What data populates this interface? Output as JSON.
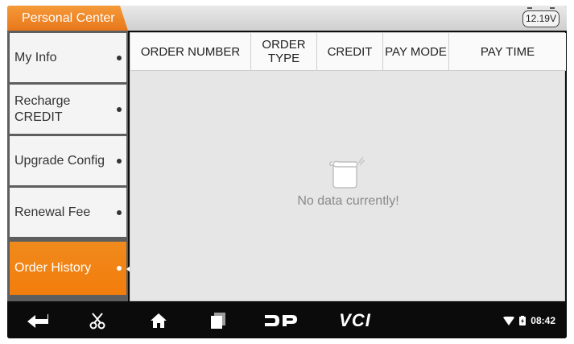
{
  "header": {
    "title": "Personal Center",
    "battery_voltage": "12.19V"
  },
  "sidebar": {
    "items": [
      {
        "label": "My Info"
      },
      {
        "label": "Recharge CREDIT"
      },
      {
        "label": "Upgrade Config"
      },
      {
        "label": "Renewal Fee"
      },
      {
        "label": "Order History"
      }
    ],
    "active_index": 4
  },
  "table": {
    "columns": [
      "ORDER NUMBER",
      "ORDER TYPE",
      "CREDIT",
      "PAY MODE",
      "PAY TIME"
    ],
    "rows": [],
    "empty_message": "No data currently!"
  },
  "navbar": {
    "buttons": [
      "back-icon",
      "scissors-icon",
      "home-icon",
      "recent-apps-icon",
      "dp-logo-icon",
      "vci-icon"
    ],
    "vci_label": "VCI",
    "clock": "08:42"
  },
  "colors": {
    "accent": "#f08a1c",
    "sidebar_bg": "#5e5e5e",
    "panel_bg": "#e6e6e6",
    "navbar_bg": "#0b0b0b"
  }
}
